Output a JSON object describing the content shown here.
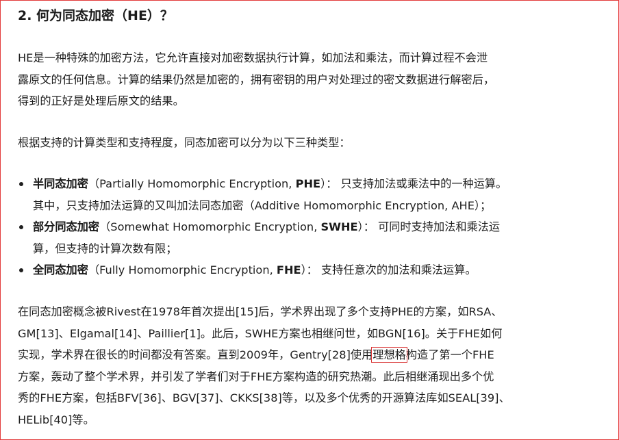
{
  "heading": "2. 何为同态加密（HE）？",
  "intro_lines": [
    "HE是一种特殊的加密方法，它允许直接对加密数据执行计算，如加法和乘法，而计算过程不会泄",
    "露原文的任何信息。计算的结果仍然是加密的，拥有密钥的用户对处理过的密文数据进行解密后，",
    "得到的正好是处理后原文的结果。"
  ],
  "types_intro": "根据支持的计算类型和支持程度，同态加密可以分为以下三种类型：",
  "types": [
    {
      "name": "半同态加密",
      "paren_open": "（Partially Homomorphic Encryption, ",
      "abbr": "PHE",
      "paren_close": "）：",
      "desc_line1": "只支持加法或乘法中的一种运算。",
      "desc_line2": "其中，只支持加法运算的又叫加法同态加密（Additive Homomorphic Encryption, AHE）；"
    },
    {
      "name": "部分同态加密",
      "paren_open": "（Somewhat Homomorphic Encryption, ",
      "abbr": "SWHE",
      "paren_close": "）：",
      "desc_line1": "可同时支持加法和乘法运",
      "desc_line2": "算，但支持的计算次数有限；"
    },
    {
      "name": "全同态加密",
      "paren_open": "（Fully Homomorphic Encryption, ",
      "abbr": "FHE",
      "paren_close": "）：",
      "desc_line1": "支持任意次的加法和乘法运算。",
      "desc_line2": ""
    }
  ],
  "history": {
    "line1": "在同态加密概念被Rivest在1978年首次提出[15]后，学术界出现了多个支持PHE的方案，如RSA、",
    "line2": "GM[13]、Elgamal[14]、Paillier[1]。此后，SWHE方案也相继问世，如BGN[16]。关于FHE如何",
    "line3_before": "实现，学术界在很长的时间都没有答案。直到2009年，Gentry[28]使用",
    "line3_highlight": "理想格",
    "line3_after": "构造了第一个FHE",
    "line4": "方案，轰动了整个学术界，并引发了学者们对于FHE方案构造的研究热潮。此后相继涌现出多个优",
    "line5": "秀的FHE方案，包括BFV[36]、BGV[37]、CKKS[38]等，以及多个优秀的开源算法库如SEAL[39]、",
    "line6": "HELib[40]等。"
  },
  "colors": {
    "text": "#1f1f1f",
    "highlight_box": "#d83333",
    "frame_border": "#e23a3a"
  }
}
